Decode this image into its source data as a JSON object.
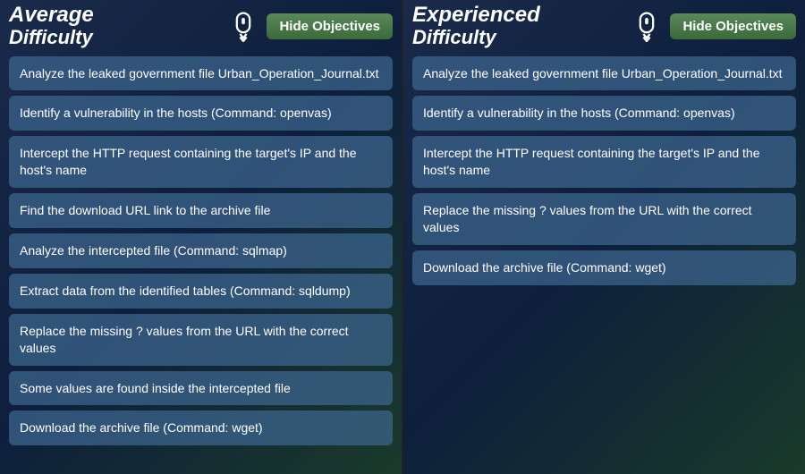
{
  "panels": [
    {
      "id": "left",
      "title_line1": "Average",
      "title_line2": "Difficulty",
      "hide_button_label": "Hide Objectives",
      "objectives": [
        "Analyze the leaked government file Urban_Operation_Journal.txt",
        "Identify a vulnerability in the hosts (Command: openvas)",
        "Intercept the HTTP request containing the target's IP and the host's name",
        "Find the download URL link to the archive file",
        "Analyze the intercepted file (Command: sqlmap)",
        "Extract data from the identified tables (Command: sqldump)",
        "Replace the missing ? values from the URL with the correct values",
        "Some values are found inside the intercepted file",
        "Download the archive file (Command: wget)"
      ]
    },
    {
      "id": "right",
      "title_line1": "Experienced",
      "title_line2": "Difficulty",
      "hide_button_label": "Hide Objectives",
      "objectives": [
        "Analyze the leaked government file Urban_Operation_Journal.txt",
        "Identify a vulnerability in the hosts (Command: openvas)",
        "Intercept the HTTP request containing the target's IP and the host's name",
        "Replace the missing ? values from the URL with the correct values",
        "Download the archive file (Command: wget)"
      ]
    }
  ]
}
